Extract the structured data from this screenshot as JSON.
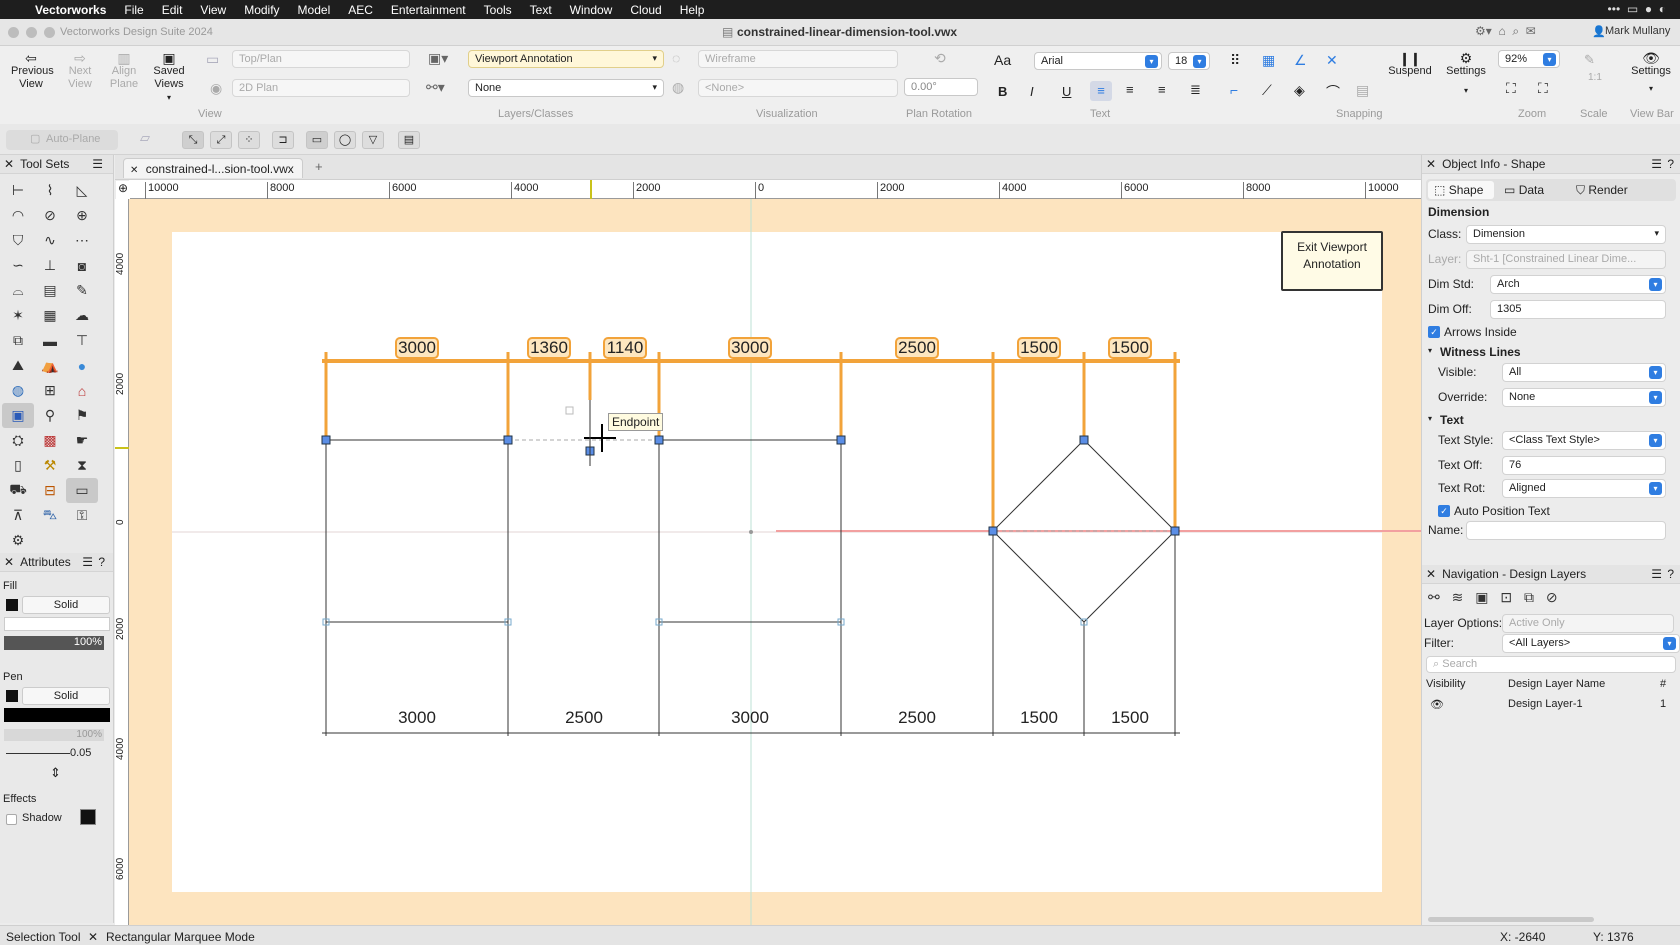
{
  "menu": {
    "items": [
      "Vectorworks",
      "File",
      "Edit",
      "View",
      "Modify",
      "Model",
      "AEC",
      "Entertainment",
      "Tools",
      "Text",
      "Window",
      "Cloud",
      "Help"
    ]
  },
  "titlebar": {
    "app_title": "Vectorworks Design Suite 2024",
    "doc_title": "constrained-linear-dimension-tool.vwx",
    "user": "Mark Mullany"
  },
  "toolbar": {
    "previous_view": "Previous View",
    "next_view": "Next View",
    "align_plane": "Align Plane",
    "saved_views": "Saved Views",
    "view_select": "Top/Plan",
    "render_select": "2D Plan",
    "group_view": "View",
    "layer_select": "Viewport Annotation",
    "class_select": "None",
    "group_layers": "Layers/Classes",
    "render_mode": "Wireframe",
    "light_select": "<None>",
    "group_visualization": "Visualization",
    "plan_rotation_value": "0.00°",
    "group_plan_rotation": "Plan Rotation",
    "font_name": "Arial",
    "font_size": "18",
    "group_text": "Text",
    "font_aa": "Aa",
    "group_snapping": "Snapping",
    "suspend": "Suspend",
    "settings": "Settings",
    "zoom_value": "92%",
    "group_zoom": "Zoom",
    "scale_label": "1:1",
    "group_scale": "Scale",
    "settings2": "Settings",
    "group_viewbar": "View Bar"
  },
  "modebar": {
    "auto_plane": "Auto-Plane"
  },
  "tool_sets": {
    "title": "Tool Sets"
  },
  "attributes": {
    "title": "Attributes",
    "fill_label": "Fill",
    "fill_style": "Solid",
    "opacity": "100%",
    "pen_label": "Pen",
    "pen_style": "Solid",
    "pen_opacity": "100%",
    "line_weight": "0.05",
    "effects_label": "Effects",
    "shadow_label": "Shadow"
  },
  "doc_tab": {
    "label": "constrained-l...sion-tool.vwx"
  },
  "ruler": {
    "top_ticks": [
      "10000",
      "8000",
      "6000",
      "4000",
      "2000",
      "0",
      "2000",
      "4000",
      "6000",
      "8000",
      "10000"
    ],
    "left_ticks": [
      "4000",
      "2000",
      "0",
      "2000",
      "4000",
      "6000"
    ]
  },
  "drawing": {
    "exit_button": "Exit Viewport Annotation",
    "top_dims": [
      "3000",
      "1360",
      "1140",
      "3000",
      "2500",
      "1500",
      "1500"
    ],
    "bottom_dims": [
      "3000",
      "2500",
      "3000",
      "2500",
      "1500",
      "1500"
    ],
    "snap_tooltip": "Endpoint"
  },
  "object_info": {
    "title": "Object Info - Shape",
    "tabs": [
      "Shape",
      "Data",
      "Render"
    ],
    "section": "Dimension",
    "class_label": "Class:",
    "class_value": "Dimension",
    "layer_label": "Layer:",
    "layer_value": "Sht-1 [Constrained Linear Dime...",
    "dim_std_label": "Dim Std:",
    "dim_std_value": "Arch",
    "dim_off_label": "Dim Off:",
    "dim_off_value": "1305",
    "arrows_inside": "Arrows Inside",
    "witness_lines": "Witness Lines",
    "visible_label": "Visible:",
    "visible_value": "All",
    "override_label": "Override:",
    "override_value": "None",
    "text_section": "Text",
    "text_style_label": "Text Style:",
    "text_style_value": "<Class Text Style>",
    "text_off_label": "Text Off:",
    "text_off_value": "76",
    "text_rot_label": "Text Rot:",
    "text_rot_value": "Aligned",
    "auto_position": "Auto Position Text",
    "name_label": "Name:"
  },
  "navigation": {
    "title": "Navigation - Design Layers",
    "layer_options_label": "Layer Options:",
    "layer_options_value": "Active Only",
    "filter_label": "Filter:",
    "filter_value": "<All Layers>",
    "search_placeholder": "Search",
    "col_visibility": "Visibility",
    "col_name": "Design Layer Name",
    "col_num": "#",
    "rows": [
      {
        "name": "Design Layer-1",
        "num": "1"
      }
    ]
  },
  "status": {
    "tool": "Selection Tool",
    "mode": "Rectangular Marquee Mode",
    "x": "X: -2640",
    "y": "Y: 1376"
  },
  "colors": {
    "accent": "#2f7de1",
    "dimension_orange": "#f2a33a",
    "canvas_bg": "#fde4bf"
  }
}
